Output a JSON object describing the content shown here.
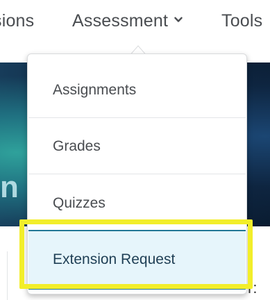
{
  "nav": {
    "items": [
      {
        "label": "sions"
      },
      {
        "label": "Assessment"
      },
      {
        "label": "Tools"
      }
    ],
    "assessment_chevron_icon": "chevron-down-icon"
  },
  "banner": {
    "partial_text": "n"
  },
  "dropdown": {
    "items": [
      {
        "label": "Assignments"
      },
      {
        "label": "Grades"
      },
      {
        "label": "Quizzes"
      },
      {
        "label": "Extension Request",
        "highlighted": true
      }
    ]
  },
  "page_fragment": {
    "partial_text": "r:"
  },
  "colors": {
    "highlight_frame": "#f2ee2a",
    "selected_item_bg": "#e6f5fb",
    "selected_item_border": "#227796",
    "nav_text": "#4a4d51"
  }
}
